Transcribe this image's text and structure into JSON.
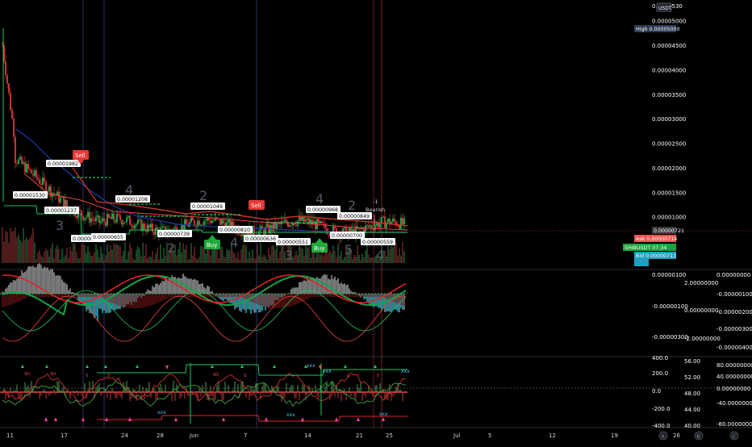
{
  "symbol": "SHIBUSDT",
  "quote_currency": "USDT",
  "colors": {
    "background": "#000000",
    "bull": "#26a69a",
    "bear": "#ef5350",
    "green": "#22c55e",
    "red": "#ef4444",
    "blue": "#1e3a8a",
    "ask": "#ef5350",
    "bid": "#2a7fd6",
    "high_tag": "#2b3a55"
  },
  "price_axis": {
    "labels": [
      "0.00005000",
      "0.00004500",
      "0.00004000",
      "0.00003500",
      "0.00003000",
      "0.00002500",
      "0.00002000",
      "0.00001500",
      "0.00001000"
    ],
    "top_partial": "0.0000530"
  },
  "price_tags": {
    "high": {
      "label": "High",
      "value": "0.00005000"
    },
    "last": {
      "value": "0.00000721"
    },
    "ask": {
      "label": "Ask",
      "value": "0.00000714"
    },
    "symbol": {
      "label": "SHIBUSDT",
      "time": "07:34"
    },
    "bid": {
      "label": "Bid",
      "value": "0.00000713"
    }
  },
  "chart_annotations": [
    {
      "text": "0.00001982"
    },
    {
      "text": "0.00001530"
    },
    {
      "text": "0.00001237"
    },
    {
      "text": "0.00000696"
    },
    {
      "text": "0.00000655"
    },
    {
      "text": "0.00001208"
    },
    {
      "text": "0.00000739"
    },
    {
      "text": "0.00001049"
    },
    {
      "text": "0.00000810"
    },
    {
      "text": "0.00000636"
    },
    {
      "text": "0.00000551"
    },
    {
      "text": "0.00000968"
    },
    {
      "text": "0.00000849"
    },
    {
      "text": "0.00000700"
    },
    {
      "text": "0.00000559"
    }
  ],
  "signals": {
    "sell": "Sell",
    "buy": "Buy",
    "bearish": "Bearish",
    "minus_one": "-1"
  },
  "wave_numbers": [
    "4",
    "2",
    "4",
    "2",
    "3",
    "4",
    "2",
    "3",
    "5",
    "4"
  ],
  "macd_pane": {
    "left_axis": [
      "0.00000100",
      "-0.00000100",
      "-0.00000300"
    ],
    "mid_axis": [
      "2.00000000",
      "0.00000000",
      "-2.00000000"
    ],
    "right_axis": [
      "0.00000000",
      "-0.00000100",
      "-0.00000200",
      "-0.00000300",
      "-0.00000400"
    ]
  },
  "osc_pane": {
    "axis_a": [
      "400.0",
      "200.0",
      "0.0",
      "-200.0",
      "-400.0"
    ],
    "axis_b": [
      "56.00",
      "52.00",
      "48.00",
      "44.00",
      "40.00"
    ],
    "axis_c": [
      "80.00000000",
      "40.00000000",
      "0.00000000",
      "-40.00000000",
      "-80.00000000"
    ]
  },
  "time_axis": [
    "11",
    "17",
    "24",
    "28",
    "Jun",
    "7",
    "14",
    "21",
    "25",
    "Jul",
    "5",
    "12",
    "19",
    "26"
  ],
  "footer_buttons": [
    "A",
    "B",
    "C"
  ]
}
